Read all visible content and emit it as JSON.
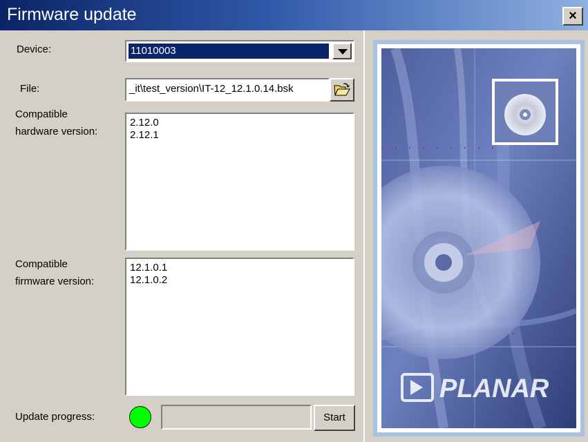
{
  "window": {
    "title": "Firmware update",
    "close_label": "×"
  },
  "device": {
    "label": "Device:",
    "value": "11010003"
  },
  "file": {
    "label": "File:",
    "value": "_it\\test_version\\IT-12_12.1.0.14.bsk"
  },
  "hardware": {
    "label_line1": "Compatible",
    "label_line2": "hardware version:",
    "items": [
      "2.12.0",
      "2.12.1"
    ]
  },
  "firmware": {
    "label_line1": "Compatible",
    "label_line2": "firmware version:",
    "items": [
      "12.1.0.1",
      "12.1.0.2"
    ]
  },
  "progress": {
    "label": "Update progress:",
    "value": 0,
    "status_color": "#00ff00",
    "start_label": "Start"
  },
  "banner": {
    "logo_text": "PLANAR"
  },
  "colors": {
    "title_bar_start": "#0b2466",
    "title_bar_end": "#8fb0e0",
    "selection": "#0a246a",
    "banner_blue": "#3a4f8e"
  }
}
